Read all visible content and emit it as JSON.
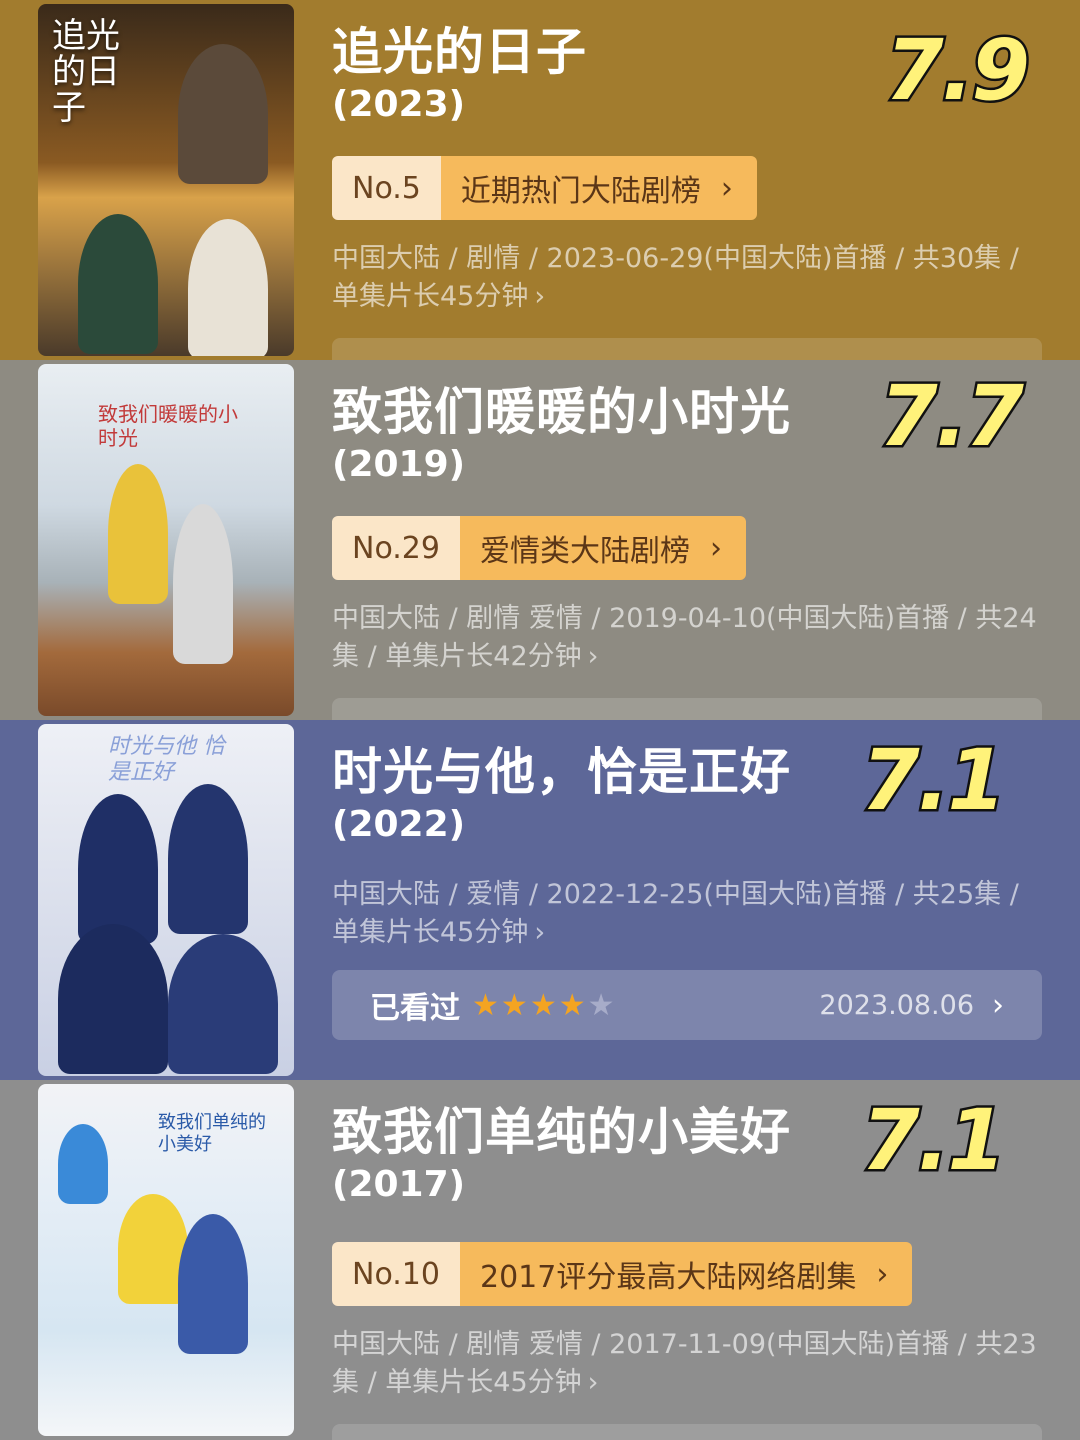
{
  "entries": [
    {
      "poster_title": "追光的日子",
      "title": "追光的日子",
      "year": "(2023)",
      "score": "7.9",
      "rank": {
        "no": "No.5",
        "name": "近期热门大陆剧榜"
      },
      "meta": "中国大陆 / 剧情 / 2023-06-29(中国大陆)首播 / 共30集 / 单集片长45分钟",
      "colors": {
        "bg": "#a27c2e"
      }
    },
    {
      "poster_title": "致我们暖暖的小时光",
      "title": "致我们暖暖的小时光",
      "year": "(2019)",
      "score": "7.7",
      "rank": {
        "no": "No.29",
        "name": "爱情类大陆剧榜"
      },
      "meta": "中国大陆 / 剧情 爱情 / 2019-04-10(中国大陆)首播 / 共24集 / 单集片长42分钟",
      "colors": {
        "bg": "#8e8b82"
      }
    },
    {
      "poster_title": "时光与他 恰是正好",
      "title": "时光与他，恰是正好",
      "year": "(2022)",
      "score": "7.1",
      "meta": "中国大陆 / 爱情 / 2022-12-25(中国大陆)首播 / 共25集 / 单集片长45分钟",
      "watched": {
        "label": "已看过",
        "stars": 4,
        "date": "2023.08.06"
      },
      "colors": {
        "bg": "#5d6798"
      }
    },
    {
      "poster_title": "致我们单纯的小美好",
      "title": "致我们单纯的小美好",
      "year": "(2017)",
      "score": "7.1",
      "rank": {
        "no": "No.10",
        "name": "2017评分最高大陆网络剧集"
      },
      "meta": "中国大陆 / 剧情 爱情 / 2017-11-09(中国大陆)首播 / 共23集 / 单集片长45分钟",
      "colors": {
        "bg": "#8e8e8e"
      }
    }
  ],
  "icons": {
    "chevron": "chevron-right-icon",
    "star": "star-icon"
  }
}
